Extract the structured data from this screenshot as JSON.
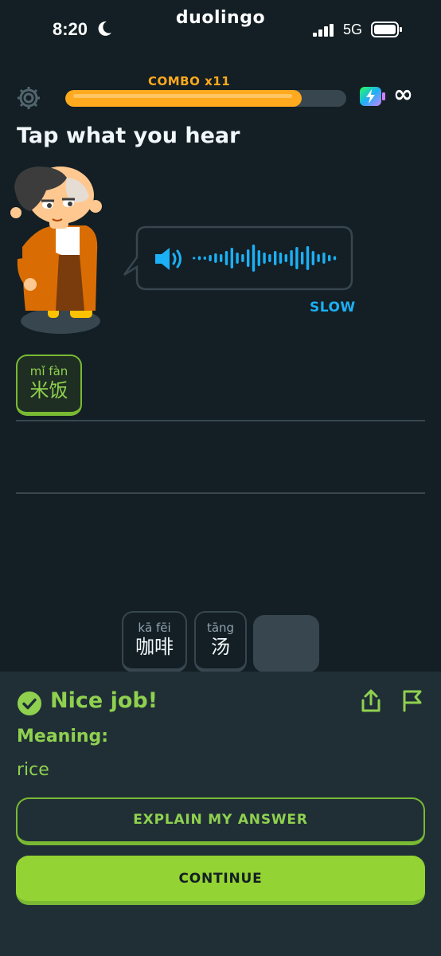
{
  "status_bar": {
    "time": "8:20",
    "app_label": "duolingo",
    "network": "5G"
  },
  "header": {
    "combo_label": "COMBO x11",
    "progress_fraction": 0.84,
    "energy_value": "∞"
  },
  "exercise": {
    "instruction": "Tap what you hear",
    "slow_label": "SLOW",
    "selected_tiles": [
      {
        "pinyin": "mǐ fàn",
        "hanzi": "米饭"
      }
    ],
    "word_bank": [
      {
        "pinyin": "kā fēi",
        "hanzi": "咖啡"
      },
      {
        "pinyin": "tāng",
        "hanzi": "汤"
      }
    ]
  },
  "feedback": {
    "status": "Nice job!",
    "meaning_label": "Meaning:",
    "meaning_value": "rice",
    "explain_label": "EXPLAIN MY ANSWER",
    "continue_label": "CONTINUE"
  },
  "colors": {
    "background": "#131f24",
    "feedback_panel": "#202f36",
    "success_green": "#8fd14f",
    "button_green": "#93d333",
    "combo_orange": "#ffa91e",
    "audio_blue": "#1cb0f6"
  },
  "icons": [
    "moon-icon",
    "signal-icon",
    "battery-icon",
    "gear-icon",
    "energy-icon",
    "speaker-icon",
    "waveform-icon",
    "check-circle-icon",
    "share-icon",
    "flag-icon"
  ]
}
